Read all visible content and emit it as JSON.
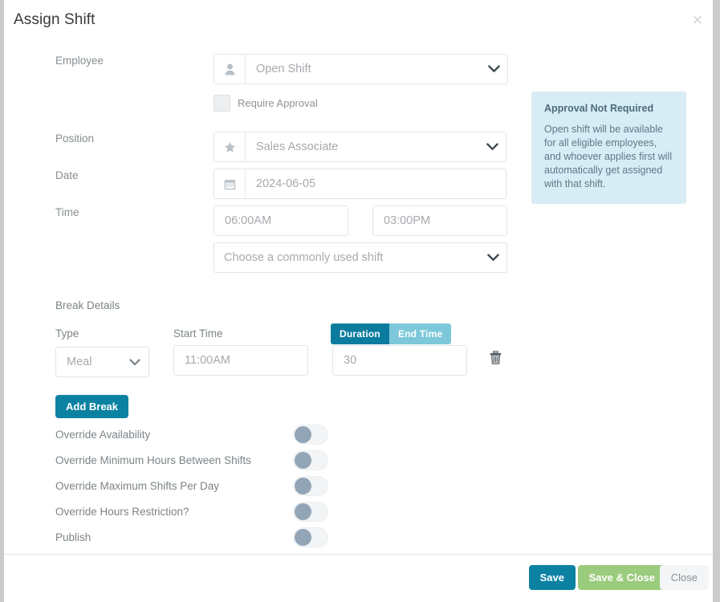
{
  "modal": {
    "title": "Assign Shift",
    "close_icon": "close-icon"
  },
  "form": {
    "employee": {
      "label": "Employee",
      "icon": "user-icon",
      "value": "Open Shift",
      "caret_icon": "chevron-down-icon"
    },
    "require_approval": {
      "label": "Require Approval",
      "checked": false
    },
    "position": {
      "label": "Position",
      "icon": "star-icon",
      "value": "Sales Associate",
      "caret_icon": "chevron-down-icon"
    },
    "date": {
      "label": "Date",
      "icon": "calendar-icon",
      "value": "2024-06-05"
    },
    "time": {
      "label": "Time",
      "start_value": "06:00AM",
      "end_value": "03:00PM"
    },
    "common_shift": {
      "placeholder": "Choose a commonly used shift",
      "caret_icon": "chevron-down-icon"
    }
  },
  "info_panel": {
    "heading": "Approval Not Required",
    "body": "Open shift will be available for all eligible employees, and whoever applies first will automatically get assigned with that shift."
  },
  "break_details": {
    "section_title": "Break Details",
    "type_label": "Type",
    "type_value": "Meal",
    "start_time_label": "Start Time",
    "start_time_value": "11:00AM",
    "segment": {
      "duration_label": "Duration",
      "end_time_label": "End Time",
      "active": "Duration"
    },
    "duration_value": "30",
    "delete_icon": "trash-icon",
    "add_break_label": "Add Break"
  },
  "toggles": [
    {
      "label": "Override Availability",
      "on": false
    },
    {
      "label": "Override Minimum Hours Between Shifts",
      "on": false
    },
    {
      "label": "Override Maximum Shifts Per Day",
      "on": false
    },
    {
      "label": "Override Hours Restriction?",
      "on": false
    },
    {
      "label": "Publish",
      "on": false
    }
  ],
  "footer": {
    "save_label": "Save",
    "save_close_label": "Save & Close",
    "close_label": "Close"
  },
  "colors": {
    "teal": "#0c82a3",
    "green": "#9bcb7c",
    "info_bg": "#d7ecf5",
    "seg_active": "#0c7c9e",
    "seg_inactive": "#7cc8da",
    "toggle_knob": "#92a5b7"
  }
}
